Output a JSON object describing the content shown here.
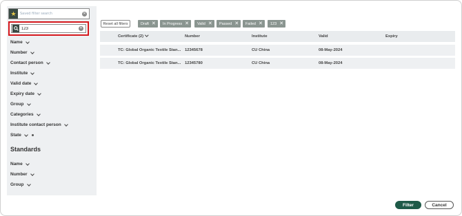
{
  "sidebar": {
    "saved_search_placeholder": "Saved filter search",
    "search_value": "123",
    "filters": [
      {
        "label": "Name"
      },
      {
        "label": "Number"
      },
      {
        "label": "Contact person"
      },
      {
        "label": "Institute"
      },
      {
        "label": "Valid date"
      },
      {
        "label": "Expiry date"
      },
      {
        "label": "Group"
      },
      {
        "label": "Categories"
      },
      {
        "label": "Institute contact person"
      },
      {
        "label": "State"
      }
    ],
    "standards_title": "Standards",
    "standards_filters": [
      {
        "label": "Name"
      },
      {
        "label": "Number"
      },
      {
        "label": "Group"
      }
    ]
  },
  "toolbar": {
    "reset_label": "Reset all filters",
    "chips": [
      "Draft",
      "In Progress",
      "Valid",
      "Passed",
      "Failed",
      "123"
    ],
    "chip_color": "#8a9590"
  },
  "table": {
    "columns": [
      "Certificate (2)",
      "Number",
      "Institute",
      "Valid",
      "Expiry"
    ],
    "rows": [
      [
        "TC: Global Organic Textile Stan...",
        "12345678",
        "CU China",
        "08-May-2024",
        ""
      ],
      [
        "TC: Global Organic Textile Stan...",
        "12345780",
        "CU China",
        "08-May-2024",
        ""
      ]
    ]
  },
  "footer": {
    "filter_label": "Filter",
    "cancel_label": "Cancel",
    "accent": "#1e5a48",
    "highlight": "#d4161b"
  }
}
